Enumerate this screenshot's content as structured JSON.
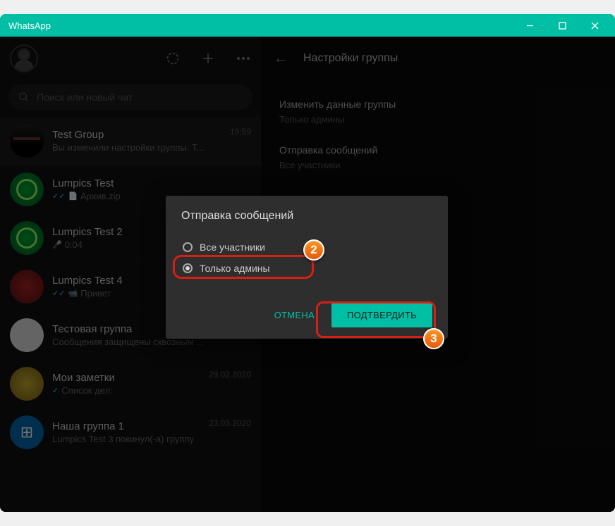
{
  "window": {
    "title": "WhatsApp"
  },
  "search": {
    "placeholder": "Поиск или новый чат"
  },
  "chats": [
    {
      "name": "Test Group",
      "sub": "Вы изменили настройки группы. Т...",
      "time": "19:59",
      "tick": false,
      "icon": ""
    },
    {
      "name": "Lumpics Test",
      "sub": "Архив.zip",
      "time": "",
      "tick": true,
      "icon": "📄"
    },
    {
      "name": "Lumpics Test 2",
      "sub": "0:04",
      "time": "",
      "tick": false,
      "icon": "🎤"
    },
    {
      "name": "Lumpics Test 4",
      "sub": "Привет",
      "time": "",
      "tick": true,
      "icon": "📹"
    },
    {
      "name": "Тестовая группа",
      "sub": "Сообщения защищены сквозным ...",
      "time": "",
      "tick": false,
      "icon": ""
    },
    {
      "name": "Мои заметки",
      "sub": "Список дел:",
      "time": "29.02.2020",
      "tick": true,
      "icon": ""
    },
    {
      "name": "Наша группа 1",
      "sub": "Lumpics Test 3 покинул(-а) группу",
      "time": "23.03.2020",
      "tick": false,
      "icon": ""
    }
  ],
  "settings": {
    "title": "Настройки группы",
    "editHeader": "Изменить данные группы",
    "editValue": "Только админы",
    "sendHeader": "Отправка сообщений",
    "sendValue": "Все участники"
  },
  "modal": {
    "title": "Отправка сообщений",
    "opt1": "Все участники",
    "opt2": "Только админы",
    "cancel": "ОТМЕНА",
    "confirm": "ПОДТВЕРДИТЬ"
  },
  "annotations": {
    "step2": "2",
    "step3": "3"
  }
}
